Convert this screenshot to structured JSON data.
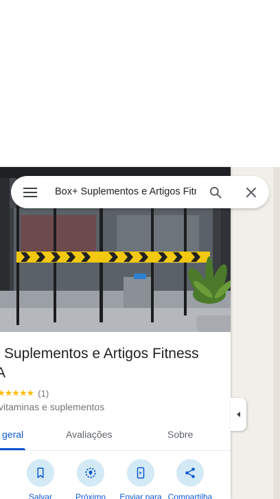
{
  "search": {
    "query": "Box+ Suplementos e Artigos Fitness",
    "menu_icon": "menu-icon",
    "search_icon": "search-icon",
    "close_icon": "close-icon"
  },
  "place": {
    "title_line1": "Suplementos e Artigos Fitness",
    "title_line2": "A",
    "stars": "★★★★★",
    "rating_count": "(1)",
    "category": "vitaminas e suplementos"
  },
  "tabs": [
    {
      "label": "geral",
      "active": true
    },
    {
      "label": "Avaliações",
      "active": false
    },
    {
      "label": "Sobre",
      "active": false
    }
  ],
  "actions": [
    {
      "label": "",
      "icon": "directions-icon"
    },
    {
      "label": "Salvar",
      "icon": "bookmark-icon"
    },
    {
      "label": "Próximo",
      "icon": "nearby-icon"
    },
    {
      "label": "Enviar para",
      "icon": "send-to-phone-icon"
    },
    {
      "label": "Compartilha",
      "icon": "share-icon"
    }
  ],
  "colors": {
    "accent": "#0b57d0",
    "star": "#fbbc04",
    "action_bg": "#d3e9f5",
    "map_bg": "#f1efe9"
  }
}
